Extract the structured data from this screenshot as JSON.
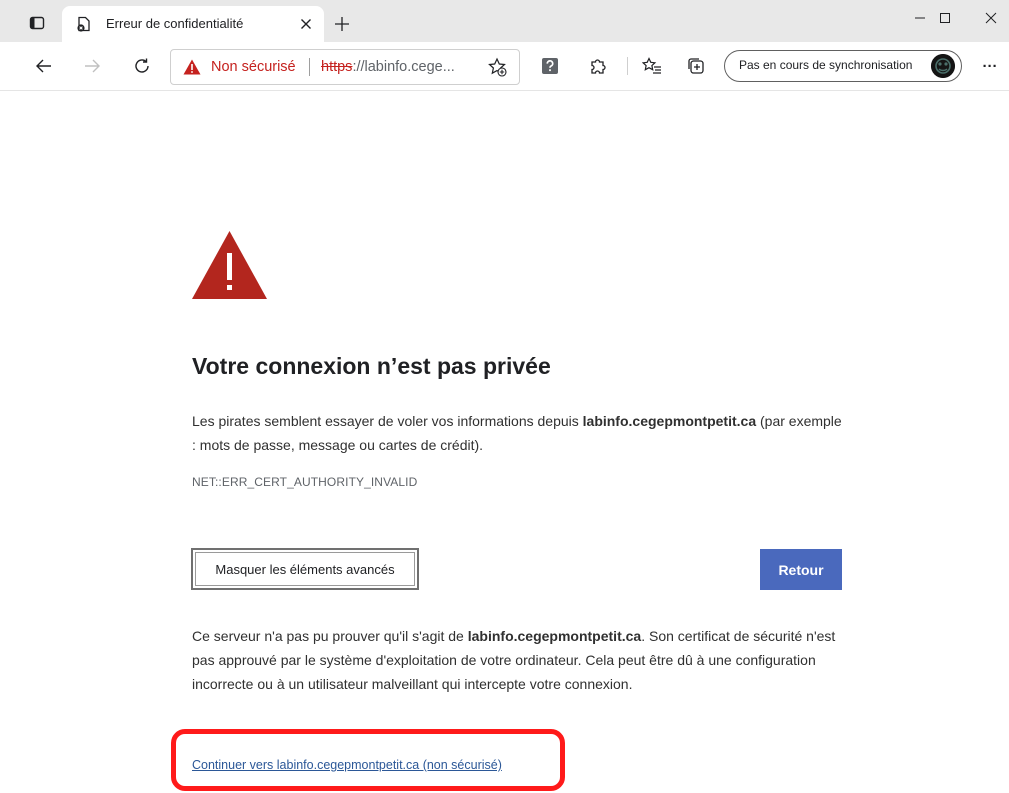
{
  "tab": {
    "title": "Erreur de confidentialité"
  },
  "address_bar": {
    "security_label": "Non sécurisé",
    "url_scheme": "https",
    "url_rest": "://labinfo.cege..."
  },
  "profile": {
    "label": "Pas en cours de synchronisation"
  },
  "toolbar": {
    "more_label": "···"
  },
  "page": {
    "heading": "Votre connexion n’est pas privée",
    "intro_before": "Les pirates semblent essayer de voler vos informations depuis ",
    "intro_host": "labinfo.cegepmontpetit.ca",
    "intro_after": " (par exemple : mots de passe, message ou cartes de crédit).",
    "error_code": "NET::ERR_CERT_AUTHORITY_INVALID",
    "advanced_button": "Masquer les éléments avancés",
    "back_button": "Retour",
    "details_before": "Ce serveur n'a pas pu prouver qu'il s'agit de ",
    "details_host": "labinfo.cegepmontpetit.ca",
    "details_after": ". Son certificat de sécurité n'est pas approuvé par le système d'exploitation de votre ordinateur. Cela peut être dû à une configuration incorrecte ou à un utilisateur malveillant qui intercepte votre connexion.",
    "continue_link": "Continuer vers labinfo.cegepmontpetit.ca (non sécurisé)"
  },
  "colors": {
    "danger": "#b3261e",
    "not_secure_text": "#c5221f",
    "back_button_bg": "#4a69bd",
    "link": "#2b5797",
    "highlight": "#ff1a1a"
  },
  "icons": {
    "tab_actions": "tab-actions-icon",
    "favicon": "privacy-error-favicon",
    "close": "close-icon",
    "new_tab": "plus-icon",
    "back": "arrow-left-icon",
    "forward": "arrow-right-icon",
    "refresh": "refresh-icon",
    "warning": "warning-triangle-icon",
    "favorites_add": "star-add-icon",
    "help": "question-icon",
    "extensions": "puzzle-icon",
    "favorites": "favorites-list-icon",
    "collections": "collections-icon",
    "more": "more-icon"
  }
}
